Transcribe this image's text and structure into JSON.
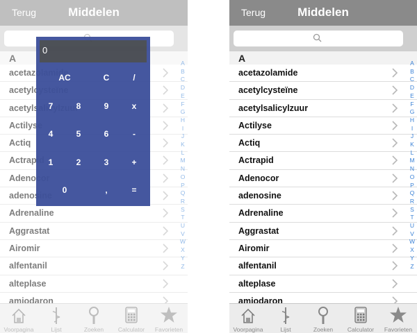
{
  "nav": {
    "back_label": "Terug",
    "title": "Middelen"
  },
  "section": {
    "letter": "A"
  },
  "items": [
    "acetazolamide",
    "acetylcysteïne",
    "acetylsalicylzuur",
    "Actilyse",
    "Actiq",
    "Actrapid",
    "Adenocor",
    "adenosine",
    "Adrenaline",
    "Aggrastat",
    "Airomir",
    "alfentanil",
    "alteplase",
    "amiodaron"
  ],
  "index": [
    "A",
    "B",
    "C",
    "D",
    "E",
    "F",
    "G",
    "H",
    "I",
    "J",
    "K",
    "L",
    "M",
    "N",
    "O",
    "P",
    "Q",
    "R",
    "S",
    "T",
    "U",
    "V",
    "W",
    "X",
    "Y",
    "Z"
  ],
  "tabs": [
    {
      "label": "Voorpagina",
      "icon": "house-icon"
    },
    {
      "label": "Lijst",
      "icon": "caduceus-icon"
    },
    {
      "label": "Zoeken",
      "icon": "magnifier-icon"
    },
    {
      "label": "Calculator",
      "icon": "calculator-icon"
    },
    {
      "label": "Favorieten",
      "icon": "star-icon"
    }
  ],
  "calculator": {
    "display": "0",
    "keys": [
      [
        "AC",
        "C",
        "/"
      ],
      [
        "7",
        "8",
        "9",
        "x"
      ],
      [
        "4",
        "5",
        "6",
        "-"
      ],
      [
        "1",
        "2",
        "3",
        "+"
      ],
      [
        "0",
        ",",
        "="
      ]
    ]
  },
  "colors": {
    "navbar": "#8a8a8a",
    "index": "#3b82d6",
    "calculator": "#3c4f9a"
  }
}
